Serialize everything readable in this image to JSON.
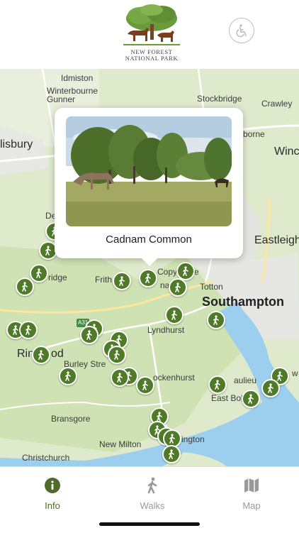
{
  "header": {
    "logo_line1": "NEW FOREST",
    "logo_line2": "NATIONAL PARK",
    "accessibility_icon": "wheelchair-icon"
  },
  "map": {
    "places": {
      "idmiston": "Idmiston",
      "winterbourne": "Winterbourne",
      "gunner": "Gunner",
      "stockbridge": "Stockbridge",
      "crawley": "Crawley",
      "salisbury": "lisbury",
      "borne": "borne",
      "winchester": "Winc",
      "eastleigh": "Eastleigh",
      "de": "De",
      "fordingbridge": "ridge",
      "frith": "Frith",
      "copythorne": "Copy",
      "copythorne_end": "e",
      "totton": "Totton",
      "ashurst": "na",
      "southampton": "Southampton",
      "lyndhurst": "Lyndhurst",
      "ringwood_start": "Rin",
      "ringwood_end": "od",
      "burley": "Burley Stre",
      "brockenhurst": "ockenhurst",
      "beaulieu": "aulieu",
      "eastboldre": "East Bol",
      "bransgore": "Bransgore",
      "newmilton": "New Milton",
      "lymington": "ington",
      "christchurch": "Christchurch",
      "w": "w",
      "road_a31": "A31"
    },
    "marker_icon": "walker-icon",
    "marker_color": "#4f7a28",
    "callout": {
      "title": "Cadnam Common"
    }
  },
  "tabbar": {
    "tabs": [
      {
        "label": "Info",
        "icon": "info-icon",
        "active": true
      },
      {
        "label": "Walks",
        "icon": "walker-icon",
        "active": false
      },
      {
        "label": "Map",
        "icon": "map-icon",
        "active": false
      }
    ],
    "active_color": "#4f6b2a",
    "inactive_color": "#9a9a9a"
  }
}
